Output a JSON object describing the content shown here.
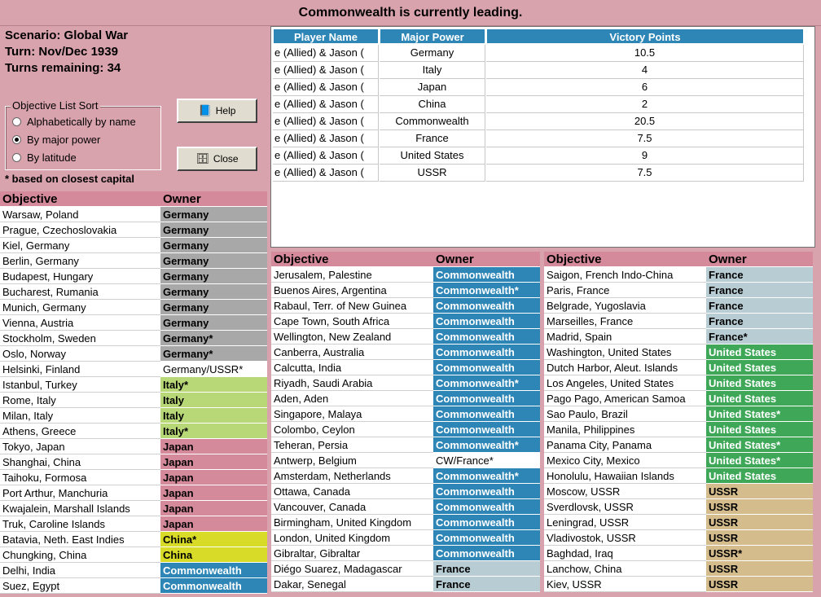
{
  "header": {
    "title": "Commonwealth is currently leading."
  },
  "scenario": {
    "scenario": "Scenario: Global War",
    "turn": "Turn: Nov/Dec 1939",
    "turns_remaining": "Turns remaining: 34"
  },
  "sort": {
    "legend": "Objective List Sort",
    "options": [
      "Alphabetically by name",
      "By major power",
      "By latitude"
    ],
    "selected_index": 1,
    "note": "* based on closest capital"
  },
  "buttons": {
    "help": "Help",
    "close": "Close"
  },
  "colors": {
    "Germany": "#a8a8a8",
    "Italy": "#b8d878",
    "Japan": "#d48a9a",
    "China": "#d8dc28",
    "Commonwealth": "#2e86b7",
    "France": "#b8ccd4",
    "United States": "#3ea858",
    "USSR": "#d4bc8c",
    "Mixed": "#ffffff"
  },
  "victory": {
    "headers": [
      "Player Name",
      "Major Power",
      "Victory Points"
    ],
    "rows": [
      [
        "e (Allied) & Jason (",
        "Germany",
        "10.5"
      ],
      [
        "e (Allied) & Jason (",
        "Italy",
        "4"
      ],
      [
        "e (Allied) & Jason (",
        "Japan",
        "6"
      ],
      [
        "e (Allied) & Jason (",
        "China",
        "2"
      ],
      [
        "e (Allied) & Jason (",
        "Commonwealth",
        "20.5"
      ],
      [
        "e (Allied) & Jason (",
        "France",
        "7.5"
      ],
      [
        "e (Allied) & Jason (",
        "United States",
        "9"
      ],
      [
        "e (Allied) & Jason (",
        "USSR",
        "7.5"
      ]
    ]
  },
  "objectives": {
    "col_objective": "Objective",
    "col_owner": "Owner",
    "left": [
      [
        "Warsaw, Poland",
        "Germany",
        "Germany"
      ],
      [
        "Prague, Czechoslovakia",
        "Germany",
        "Germany"
      ],
      [
        "Kiel, Germany",
        "Germany",
        "Germany"
      ],
      [
        "Berlin, Germany",
        "Germany",
        "Germany"
      ],
      [
        "Budapest, Hungary",
        "Germany",
        "Germany"
      ],
      [
        "Bucharest, Rumania",
        "Germany",
        "Germany"
      ],
      [
        "Munich, Germany",
        "Germany",
        "Germany"
      ],
      [
        "Vienna, Austria",
        "Germany",
        "Germany"
      ],
      [
        "Stockholm, Sweden",
        "Germany*",
        "Germany"
      ],
      [
        "Oslo, Norway",
        "Germany*",
        "Germany"
      ],
      [
        "Helsinki, Finland",
        "Germany/USSR*",
        "Mixed"
      ],
      [
        "Istanbul, Turkey",
        "Italy*",
        "Italy"
      ],
      [
        "Rome, Italy",
        "Italy",
        "Italy"
      ],
      [
        "Milan, Italy",
        "Italy",
        "Italy"
      ],
      [
        "Athens, Greece",
        "Italy*",
        "Italy"
      ],
      [
        "Tokyo, Japan",
        "Japan",
        "Japan"
      ],
      [
        "Shanghai, China",
        "Japan",
        "Japan"
      ],
      [
        "Taihoku, Formosa",
        "Japan",
        "Japan"
      ],
      [
        "Port Arthur, Manchuria",
        "Japan",
        "Japan"
      ],
      [
        "Kwajalein, Marshall Islands",
        "Japan",
        "Japan"
      ],
      [
        "Truk, Caroline Islands",
        "Japan",
        "Japan"
      ],
      [
        "Batavia, Neth. East Indies",
        "China*",
        "China"
      ],
      [
        "Chungking, China",
        "China",
        "China"
      ],
      [
        "Delhi, India",
        "Commonwealth",
        "Commonwealth"
      ],
      [
        "Suez, Egypt",
        "Commonwealth",
        "Commonwealth"
      ]
    ],
    "middle": [
      [
        "Jerusalem, Palestine",
        "Commonwealth",
        "Commonwealth"
      ],
      [
        "Buenos Aires, Argentina",
        "Commonwealth*",
        "Commonwealth"
      ],
      [
        "Rabaul, Terr. of New Guinea",
        "Commonwealth",
        "Commonwealth"
      ],
      [
        "Cape Town, South Africa",
        "Commonwealth",
        "Commonwealth"
      ],
      [
        "Wellington, New Zealand",
        "Commonwealth",
        "Commonwealth"
      ],
      [
        "Canberra, Australia",
        "Commonwealth",
        "Commonwealth"
      ],
      [
        "Calcutta, India",
        "Commonwealth",
        "Commonwealth"
      ],
      [
        "Riyadh, Saudi Arabia",
        "Commonwealth*",
        "Commonwealth"
      ],
      [
        "Aden, Aden",
        "Commonwealth",
        "Commonwealth"
      ],
      [
        "Singapore, Malaya",
        "Commonwealth",
        "Commonwealth"
      ],
      [
        "Colombo, Ceylon",
        "Commonwealth",
        "Commonwealth"
      ],
      [
        "Teheran, Persia",
        "Commonwealth*",
        "Commonwealth"
      ],
      [
        "Antwerp, Belgium",
        "CW/France*",
        "Mixed"
      ],
      [
        "Amsterdam, Netherlands",
        "Commonwealth*",
        "Commonwealth"
      ],
      [
        "Ottawa, Canada",
        "Commonwealth",
        "Commonwealth"
      ],
      [
        "Vancouver, Canada",
        "Commonwealth",
        "Commonwealth"
      ],
      [
        "Birmingham, United Kingdom",
        "Commonwealth",
        "Commonwealth"
      ],
      [
        "London, United Kingdom",
        "Commonwealth",
        "Commonwealth"
      ],
      [
        "Gibraltar, Gibraltar",
        "Commonwealth",
        "Commonwealth"
      ],
      [
        "Diégo Suarez, Madagascar",
        "France",
        "France"
      ],
      [
        "Dakar, Senegal",
        "France",
        "France"
      ]
    ],
    "right": [
      [
        "Saigon, French Indo-China",
        "France",
        "France"
      ],
      [
        "Paris, France",
        "France",
        "France"
      ],
      [
        "Belgrade, Yugoslavia",
        "France",
        "France"
      ],
      [
        "Marseilles, France",
        "France",
        "France"
      ],
      [
        "Madrid, Spain",
        "France*",
        "France"
      ],
      [
        "Washington, United States",
        "United States",
        "United States"
      ],
      [
        "Dutch Harbor, Aleut. Islands",
        "United States",
        "United States"
      ],
      [
        "Los Angeles, United States",
        "United States",
        "United States"
      ],
      [
        "Pago Pago, American Samoa",
        "United States",
        "United States"
      ],
      [
        "Sao Paulo, Brazil",
        "United States*",
        "United States"
      ],
      [
        "Manila, Philippines",
        "United States",
        "United States"
      ],
      [
        "Panama City, Panama",
        "United States*",
        "United States"
      ],
      [
        "Mexico City, Mexico",
        "United States*",
        "United States"
      ],
      [
        "Honolulu, Hawaiian Islands",
        "United States",
        "United States"
      ],
      [
        "Moscow, USSR",
        "USSR",
        "USSR"
      ],
      [
        "Sverdlovsk, USSR",
        "USSR",
        "USSR"
      ],
      [
        "Leningrad, USSR",
        "USSR",
        "USSR"
      ],
      [
        "Vladivostok, USSR",
        "USSR",
        "USSR"
      ],
      [
        "Baghdad, Iraq",
        "USSR*",
        "USSR"
      ],
      [
        "Lanchow, China",
        "USSR",
        "USSR"
      ],
      [
        "Kiev, USSR",
        "USSR",
        "USSR"
      ]
    ]
  }
}
